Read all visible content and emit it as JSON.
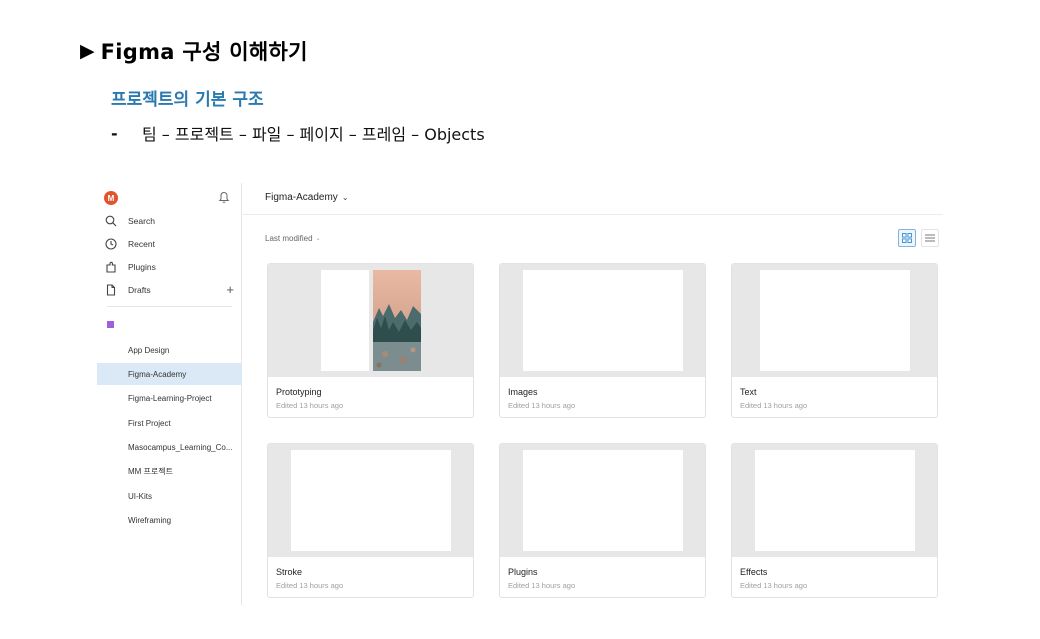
{
  "slide": {
    "title_marker": "▶",
    "title": "Figma 구성 이해하기",
    "subtitle": "프로젝트의 기본 구조",
    "bullet_dash": "-",
    "bullet_text": "팀 – 프로젝트 – 파일 – 페이지 – 프레임 – Objects"
  },
  "sidebar": {
    "avatar_initial": "M",
    "nav": [
      {
        "label": "Search",
        "icon": "search-icon"
      },
      {
        "label": "Recent",
        "icon": "clock-icon"
      },
      {
        "label": "Plugins",
        "icon": "plugin-icon"
      },
      {
        "label": "Drafts",
        "icon": "file-icon"
      }
    ],
    "drafts_add": "+",
    "projects": [
      "App Design",
      "Figma-Academy",
      "Figma-Learning-Project",
      "First Project",
      "Masocampus_Learning_Co...",
      "MM 프로젝트",
      "UI-Kits",
      "Wireframing"
    ],
    "active_project_index": 1,
    "team_color": "#9b5fe0"
  },
  "header": {
    "team_name": "Figma-Academy",
    "chevron": "⌄"
  },
  "toolbar": {
    "sort_label": "Last modified",
    "sort_chevron": "⌄",
    "active_view": "grid"
  },
  "files": [
    {
      "name": "Prototyping",
      "edited": "Edited 13 hours ago"
    },
    {
      "name": "Images",
      "edited": "Edited 13 hours ago"
    },
    {
      "name": "Text",
      "edited": "Edited 13 hours ago"
    },
    {
      "name": "Stroke",
      "edited": "Edited 13 hours ago"
    },
    {
      "name": "Plugins",
      "edited": "Edited 13 hours ago"
    },
    {
      "name": "Effects",
      "edited": "Edited 13 hours ago"
    }
  ],
  "colors": {
    "accent": "#2a7ab0",
    "avatar": "#e0552f",
    "active_row": "#dbe9f6"
  }
}
